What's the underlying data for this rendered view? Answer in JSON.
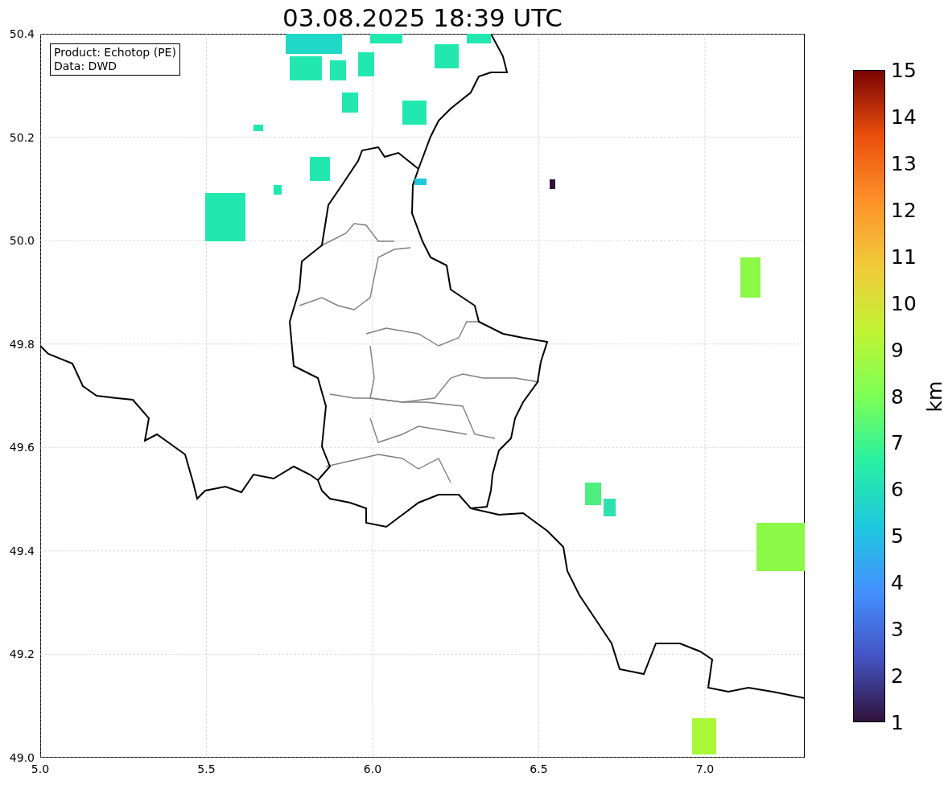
{
  "title": "03.08.2025 18:39 UTC",
  "legend": [
    "Product: Echotop (PE)",
    "Data: DWD"
  ],
  "x_ticks": [
    "5.0",
    "5.5",
    "6.0",
    "6.5",
    "7.0"
  ],
  "y_ticks": [
    "50.4",
    "50.2",
    "50.0",
    "49.8",
    "49.6",
    "49.4",
    "49.2",
    "49.0"
  ],
  "colorbar": {
    "label": "km",
    "ticks": [
      "15",
      "14",
      "13",
      "12",
      "11",
      "10",
      "9",
      "8",
      "7",
      "6",
      "5",
      "4",
      "3",
      "2",
      "1"
    ]
  }
}
